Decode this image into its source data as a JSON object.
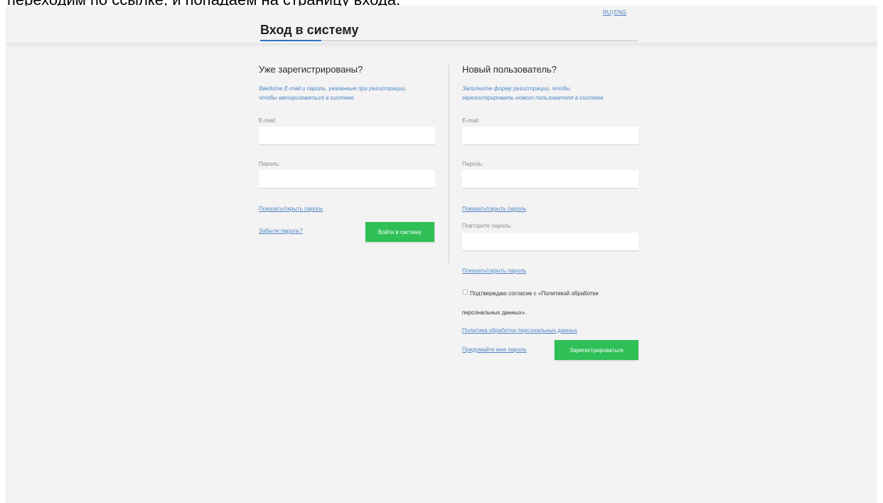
{
  "top_caption": "переходим по ссылке, и попадаем на страницу входа:",
  "lang": {
    "ru": "RU",
    "sep": "|",
    "en": "ENG"
  },
  "page_title": "Вход в систему",
  "login": {
    "title": "Уже зарегистрированы?",
    "subtitle_line1": "Введите E-mail и пароль, указанные при регистрации,",
    "subtitle_line2": "чтобы авторизоваться в системе",
    "email_label": "E-mail:",
    "email_value": "",
    "password_label": "Пароль:",
    "password_value": "",
    "toggle_password": "Показать/скрыть пароль",
    "forgot_password": "Забыли пароль?",
    "submit_label": "Войти в систему"
  },
  "register": {
    "title": "Новый пользователь?",
    "subtitle_line1": "Заполните форму регистрации, чтобы",
    "subtitle_line2": "зарегистрировать нового пользователя в системе",
    "email_label": "E-mail:",
    "email_value": "",
    "password_label": "Пароль:",
    "password_value": "",
    "toggle_password": "Показать/скрыть пароль",
    "repeat_password_label": "Повторите пароль:",
    "repeat_password_value": "",
    "toggle_repeat_password": "Показать/скрыть пароль",
    "consent_line1": "Подтверждаю согласие с «Политикой обработки",
    "consent_line2": "персональных данных».",
    "consent_checked": false,
    "policy_link": "Политика обработки персональных данных",
    "generate_password": "Придумайте мне пароль",
    "submit_label": "Зарегистрироваться"
  },
  "colors": {
    "accent_green": "#2fbf57",
    "link_blue": "#4f86c6",
    "title_underline": "#2d73c5",
    "background": "#f3f3f3"
  }
}
